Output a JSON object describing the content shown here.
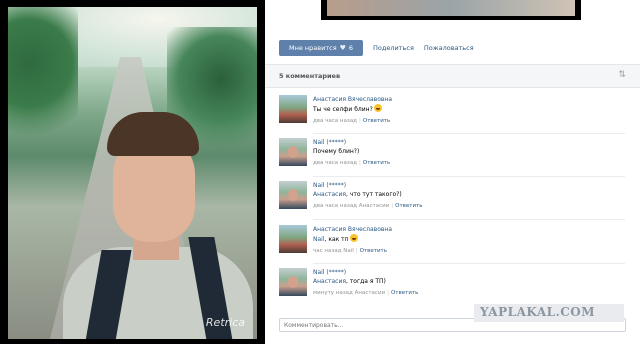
{
  "photo": {
    "watermark_text": "Retrica"
  },
  "post": {
    "like_label": "Мне нравится",
    "like_count": "6",
    "share_label": "Поделиться",
    "complain_label": "Пожаловаться"
  },
  "comments_header": {
    "count_label": "5 комментариев"
  },
  "comments": [
    {
      "author": "Анастасия Вячеславовна",
      "text": "Ты че селфи блин?",
      "reply_to": "",
      "time": "два часа назад",
      "reply_label": "Ответить"
    },
    {
      "author": "Nail (*****)",
      "text": "Почему блин?)",
      "reply_to": "",
      "time": "два часа назад",
      "reply_label": "Ответить"
    },
    {
      "author": "Nail (*****)",
      "text": ", что тут такого?)",
      "reply_to": "Анастасия",
      "time": "два часа назад Анастасии",
      "reply_label": "Ответить"
    },
    {
      "author": "Анастасия Вячеславовна",
      "text": ", как тп",
      "reply_to": "Nail",
      "time": "час назад Nail",
      "reply_label": "Ответить"
    },
    {
      "author": "Nail (*****)",
      "text": ", тогда я ТП)",
      "reply_to": "Анастасия",
      "time": "минуту назад Анастасии",
      "reply_label": "Ответить"
    }
  ],
  "comment_input": {
    "placeholder": "Комментировать..."
  },
  "site_watermark": "YAPLAKAL.COM"
}
